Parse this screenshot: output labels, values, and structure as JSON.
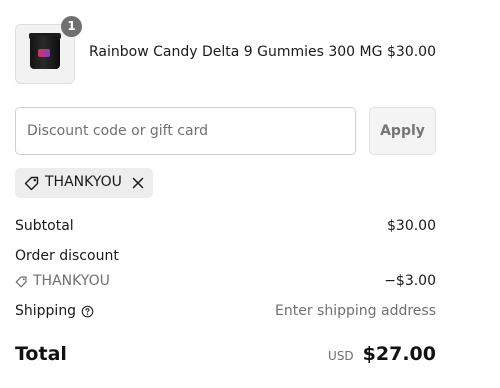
{
  "product": {
    "quantity": "1",
    "title": "Rainbow Candy Delta 9 Gummies 300 MG",
    "price": "$30.00",
    "image_icon": "gummy-jar-image"
  },
  "discount_form": {
    "placeholder": "Discount code or gift card",
    "value": "",
    "apply_label": "Apply"
  },
  "applied_code": {
    "code": "THANKYOU",
    "icon": "tag-icon",
    "remove_icon": "close-icon"
  },
  "summary": {
    "subtotal_label": "Subtotal",
    "subtotal_value": "$30.00",
    "order_discount_label": "Order discount",
    "discount_code": "THANKYOU",
    "discount_amount": "−$3.00",
    "shipping_label": "Shipping",
    "shipping_value": "Enter shipping address",
    "shipping_help_icon": "question-circle-icon",
    "total_label": "Total",
    "currency": "USD",
    "total_value": "$27.00"
  }
}
